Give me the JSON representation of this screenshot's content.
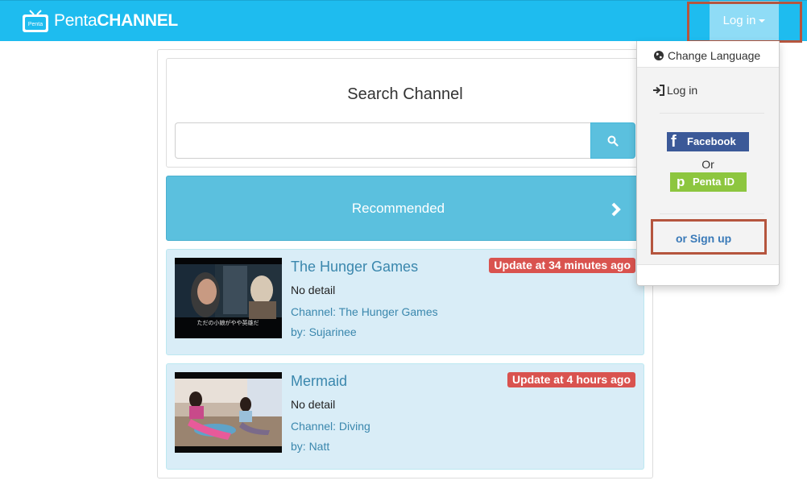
{
  "navbar": {
    "brand_prefix": "Penta",
    "brand_suffix": "CHANNEL",
    "logo_text": "Penta",
    "login_label": "Log in",
    "bg_color": "#1ebcef"
  },
  "search": {
    "title": "Search Channel",
    "input_value": "",
    "button_icon": "search-icon"
  },
  "recommended": {
    "label": "Recommended",
    "icon": "chevron-right-icon"
  },
  "items": [
    {
      "title": "The Hunger Games",
      "badge": "Update at 34 minutes ago",
      "detail": "No detail",
      "channel": "Channel: The Hunger Games",
      "by": "by: Sujarinee",
      "thumb_caption": "ただの小娘がやや英雄だ"
    },
    {
      "title": "Mermaid",
      "badge": "Update at 4 hours ago",
      "detail": "No detail",
      "channel": "Channel: Diving",
      "by": "by: Natt"
    }
  ],
  "dropdown": {
    "change_language": "Change Language",
    "login": "Log in",
    "facebook": "Facebook",
    "or": "Or",
    "penta_id": "Penta ID",
    "signup": "or Sign up"
  },
  "colors": {
    "accent": "#5bc0de",
    "badge": "#d9534f",
    "facebook": "#3b5998",
    "penta": "#8dc63f",
    "highlight": "#b5553e"
  }
}
